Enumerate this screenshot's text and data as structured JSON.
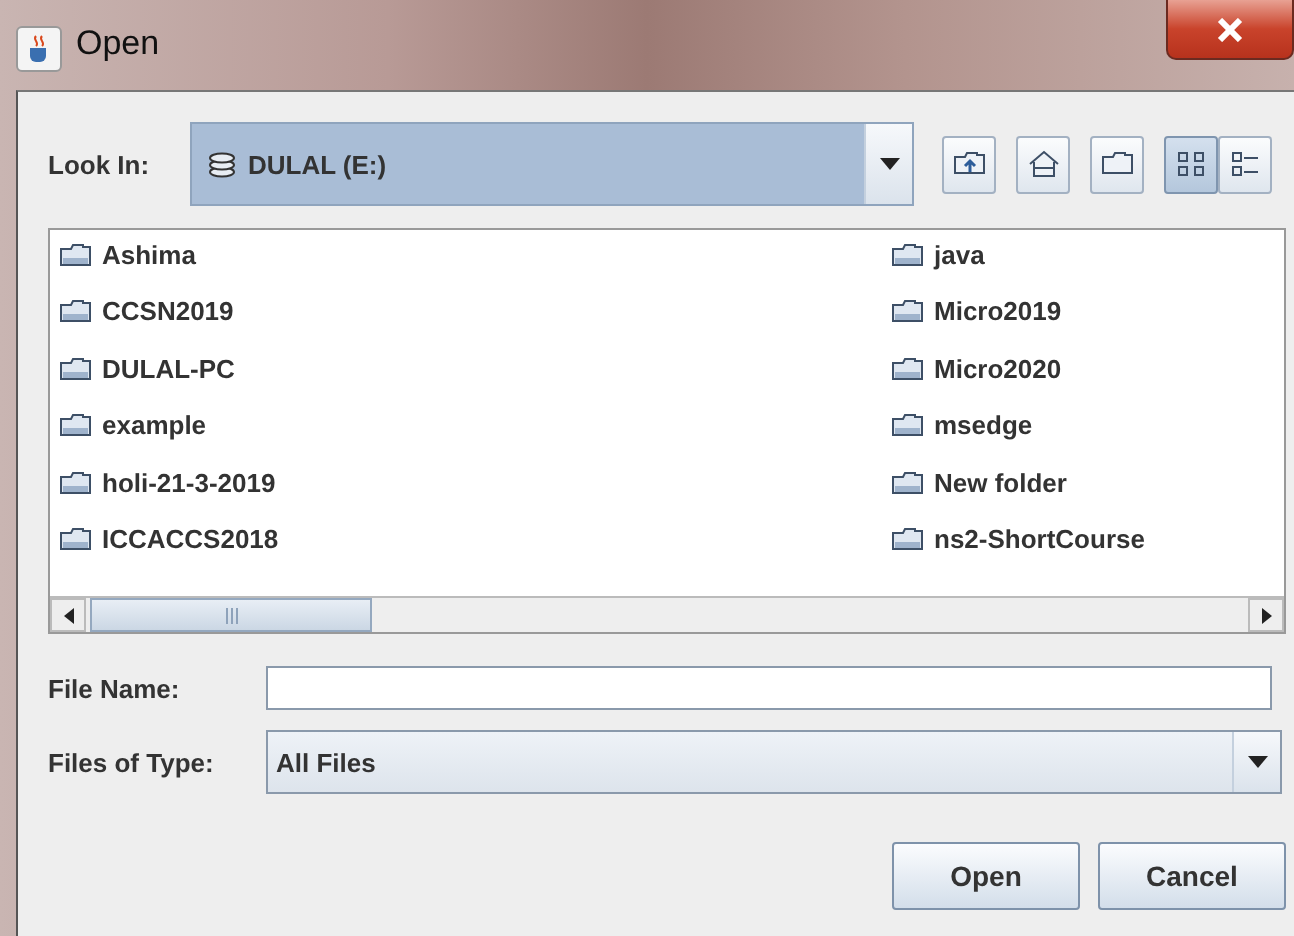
{
  "window": {
    "title": "Open"
  },
  "look_in": {
    "label": "Look In:",
    "value": "DULAL (E:)"
  },
  "view_buttons": [
    {
      "kind": "list",
      "selected": true
    },
    {
      "kind": "details",
      "selected": false
    }
  ],
  "files": [
    {
      "name": "Ashima"
    },
    {
      "name": "CCSN2019"
    },
    {
      "name": "DULAL-PC"
    },
    {
      "name": "example"
    },
    {
      "name": "holi-21-3-2019"
    },
    {
      "name": "ICCACCS2018"
    },
    {
      "name": "java"
    },
    {
      "name": "Micro2019"
    },
    {
      "name": "Micro2020"
    },
    {
      "name": "msedge"
    },
    {
      "name": "New folder"
    },
    {
      "name": "ns2-ShortCourse"
    }
  ],
  "file_name": {
    "label": "File Name:"
  },
  "files_of_type": {
    "label": "Files of Type:",
    "value": "All Files"
  },
  "buttons": [
    {
      "label": "Open"
    },
    {
      "label": "Cancel"
    }
  ]
}
